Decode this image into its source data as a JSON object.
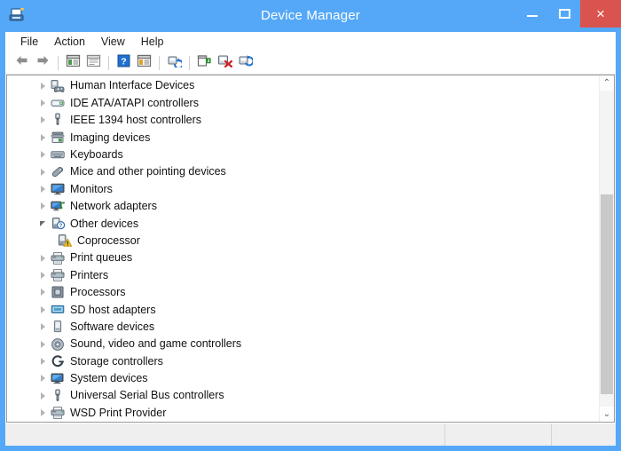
{
  "window": {
    "title": "Device Manager",
    "icon": "device-manager-icon",
    "accent_color": "#54a8f7",
    "close_color": "#d9534f"
  },
  "caption_buttons": [
    {
      "name": "minimize-button",
      "glyph": "minimize"
    },
    {
      "name": "maximize-button",
      "glyph": "maximize"
    },
    {
      "name": "close-button",
      "glyph": "×"
    }
  ],
  "menubar": {
    "items": [
      {
        "label": "File",
        "name": "menu-file"
      },
      {
        "label": "Action",
        "name": "menu-action"
      },
      {
        "label": "View",
        "name": "menu-view"
      },
      {
        "label": "Help",
        "name": "menu-help"
      }
    ]
  },
  "toolbar": {
    "buttons": [
      {
        "name": "back-button",
        "icon": "back-arrow-icon",
        "enabled": false
      },
      {
        "name": "forward-button",
        "icon": "forward-arrow-icon",
        "enabled": false
      },
      {
        "name": "separator-1",
        "icon": "separator"
      },
      {
        "name": "show-hide-console-tree-button",
        "icon": "console-tree-icon"
      },
      {
        "name": "properties-button",
        "icon": "properties-window-icon"
      },
      {
        "name": "separator-2",
        "icon": "separator"
      },
      {
        "name": "help-button",
        "icon": "help-question-icon"
      },
      {
        "name": "device-properties-button",
        "icon": "device-properties-icon"
      },
      {
        "name": "separator-3",
        "icon": "separator"
      },
      {
        "name": "update-driver-button",
        "icon": "update-driver-icon"
      },
      {
        "name": "separator-4",
        "icon": "separator"
      },
      {
        "name": "enable-device-button",
        "icon": "enable-device-icon"
      },
      {
        "name": "disable-device-button",
        "icon": "disable-device-icon"
      },
      {
        "name": "scan-for-hardware-changes-button",
        "icon": "scan-hardware-icon"
      }
    ]
  },
  "tree": {
    "items": [
      {
        "label": "Human Interface Devices",
        "icon": "hid-gamepad-icon",
        "state": "collapsed",
        "level": 0,
        "warning": false
      },
      {
        "label": "IDE ATA/ATAPI controllers",
        "icon": "ide-controller-icon",
        "state": "collapsed",
        "level": 0,
        "warning": false
      },
      {
        "label": "IEEE 1394 host controllers",
        "icon": "ieee1394-plug-icon",
        "state": "collapsed",
        "level": 0,
        "warning": false
      },
      {
        "label": "Imaging devices",
        "icon": "imaging-scanner-icon",
        "state": "collapsed",
        "level": 0,
        "warning": false
      },
      {
        "label": "Keyboards",
        "icon": "keyboard-icon",
        "state": "collapsed",
        "level": 0,
        "warning": false
      },
      {
        "label": "Mice and other pointing devices",
        "icon": "mouse-icon",
        "state": "collapsed",
        "level": 0,
        "warning": false
      },
      {
        "label": "Monitors",
        "icon": "monitor-icon",
        "state": "collapsed",
        "level": 0,
        "warning": false
      },
      {
        "label": "Network adapters",
        "icon": "network-adapter-icon",
        "state": "collapsed",
        "level": 0,
        "warning": false
      },
      {
        "label": "Other devices",
        "icon": "unknown-device-icon",
        "state": "expanded",
        "level": 0,
        "warning": false
      },
      {
        "label": "Coprocessor",
        "icon": "unknown-device-icon",
        "state": "leaf",
        "level": 1,
        "warning": true
      },
      {
        "label": "Print queues",
        "icon": "printer-icon",
        "state": "collapsed",
        "level": 0,
        "warning": false
      },
      {
        "label": "Printers",
        "icon": "printer-icon",
        "state": "collapsed",
        "level": 0,
        "warning": false
      },
      {
        "label": "Processors",
        "icon": "processor-icon",
        "state": "collapsed",
        "level": 0,
        "warning": false
      },
      {
        "label": "SD host adapters",
        "icon": "sd-host-adapter-icon",
        "state": "collapsed",
        "level": 0,
        "warning": false
      },
      {
        "label": "Software devices",
        "icon": "software-device-icon",
        "state": "collapsed",
        "level": 0,
        "warning": false
      },
      {
        "label": "Sound, video and game controllers",
        "icon": "sound-controller-icon",
        "state": "collapsed",
        "level": 0,
        "warning": false
      },
      {
        "label": "Storage controllers",
        "icon": "storage-controller-icon",
        "state": "collapsed",
        "level": 0,
        "warning": false
      },
      {
        "label": "System devices",
        "icon": "system-device-icon",
        "state": "collapsed",
        "level": 0,
        "warning": false
      },
      {
        "label": "Universal Serial Bus controllers",
        "icon": "usb-controller-icon",
        "state": "collapsed",
        "level": 0,
        "warning": false
      },
      {
        "label": "WSD Print Provider",
        "icon": "printer-icon",
        "state": "collapsed",
        "level": 0,
        "warning": false
      }
    ]
  },
  "scrollbar": {
    "up_glyph": "⌃",
    "down_glyph": "⌄",
    "thumb_top_pct": 33,
    "thumb_height_pct": 63
  },
  "statusbar": {
    "panes": [
      "",
      "",
      ""
    ]
  }
}
